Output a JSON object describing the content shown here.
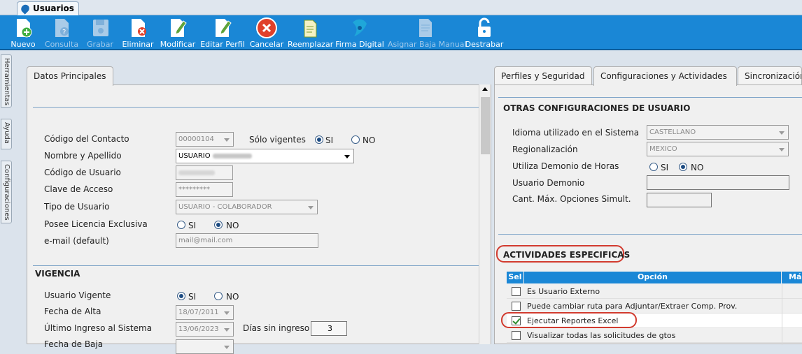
{
  "window": {
    "tab_title": "Usuarios"
  },
  "toolbar": {
    "buttons": [
      {
        "label": "Nuevo",
        "icon": "new-doc-icon",
        "enabled": true
      },
      {
        "label": "Consulta",
        "icon": "query-doc-icon",
        "enabled": false
      },
      {
        "label": "Grabar",
        "icon": "save-disk-icon",
        "enabled": false
      },
      {
        "label": "Eliminar",
        "icon": "delete-doc-icon",
        "enabled": true
      },
      {
        "label": "Modificar",
        "icon": "edit-doc-icon",
        "enabled": true
      },
      {
        "label": "Editar Perfil",
        "icon": "edit-profile-icon",
        "enabled": true
      },
      {
        "label": "Cancelar",
        "icon": "cancel-icon",
        "enabled": true
      },
      {
        "label": "Reemplazar",
        "icon": "replace-doc-icon",
        "enabled": true
      },
      {
        "label": "Firma Digital",
        "icon": "digital-signature-icon",
        "enabled": true
      },
      {
        "label": "Asignar Baja Manual",
        "icon": "manual-removal-icon",
        "enabled": false
      },
      {
        "label": "Destrabar",
        "icon": "unlock-icon",
        "enabled": true
      }
    ],
    "colors": {
      "bg": "#1a87d6",
      "text": "#ffffff",
      "disabled_text": "#9fc8ea"
    }
  },
  "side_tabs": [
    "Herramientas",
    "Ayuda",
    "Configuraciones"
  ],
  "left": {
    "tab": "Datos Principales",
    "fields": {
      "codigo_contacto": {
        "label": "Código del Contacto",
        "value": "00000104"
      },
      "solo_vigentes": {
        "label": "Sólo vigentes",
        "si": "SI",
        "no": "NO",
        "selected": "SI"
      },
      "nombre": {
        "label": "Nombre y Apellido",
        "value": "USUARIO"
      },
      "codigo_usuario": {
        "label": "Código de Usuario"
      },
      "clave": {
        "label": "Clave de Acceso",
        "value": "*********"
      },
      "tipo_usuario": {
        "label": "Tipo de Usuario",
        "value": "USUARIO - COLABORADOR"
      },
      "licencia": {
        "label": "Posee Licencia Exclusiva",
        "si": "SI",
        "no": "NO",
        "selected": "NO"
      },
      "email": {
        "label": "e-mail (default)",
        "value": "mail@mail.com"
      }
    },
    "vigencia": {
      "title": "VIGENCIA",
      "usuario_vigente": {
        "label": "Usuario Vigente",
        "si": "SI",
        "no": "NO",
        "selected": "SI"
      },
      "fecha_alta": {
        "label": "Fecha de Alta",
        "value": "18/07/2011"
      },
      "ultimo_ingreso": {
        "label": "Último Ingreso al Sistema",
        "value": "13/06/2023"
      },
      "dias_sin_ingreso": {
        "label": "Días sin ingreso",
        "value": "3"
      },
      "fecha_baja": {
        "label": "Fecha de Baja"
      }
    }
  },
  "right": {
    "tabs": [
      "Perfiles y Seguridad",
      "Configuraciones y Actividades",
      "Sincronización"
    ],
    "active_tab": "Configuraciones y Actividades",
    "otras": {
      "title": "OTRAS CONFIGURACIONES DE USUARIO",
      "idioma": {
        "label": "Idioma utilizado en el Sistema",
        "value": "CASTELLANO"
      },
      "regionalizacion": {
        "label": "Regionalización",
        "value": "MEXICO"
      },
      "demonio_horas": {
        "label": "Utiliza Demonio de Horas",
        "si": "SI",
        "no": "NO",
        "selected": "NO"
      },
      "usuario_demonio": {
        "label": "Usuario Demonio",
        "value": ""
      },
      "cant_max": {
        "label": "Cant. Máx. Opciones Simult.",
        "value": ""
      }
    },
    "actividades": {
      "title": "ACTIVIDADES ESPECIFICAS",
      "columns": [
        "Sel",
        "Opción",
        "Más"
      ],
      "rows": [
        {
          "option": "Es Usuario Externo",
          "checked": false
        },
        {
          "option": "Puede cambiar ruta para Adjuntar/Extraer Comp. Prov.",
          "checked": false
        },
        {
          "option": "Ejecutar Reportes Excel",
          "checked": true
        },
        {
          "option": "Visualizar todas las solicitudes de gtos",
          "checked": false
        }
      ]
    },
    "highlight_color": "#d23b2f"
  }
}
